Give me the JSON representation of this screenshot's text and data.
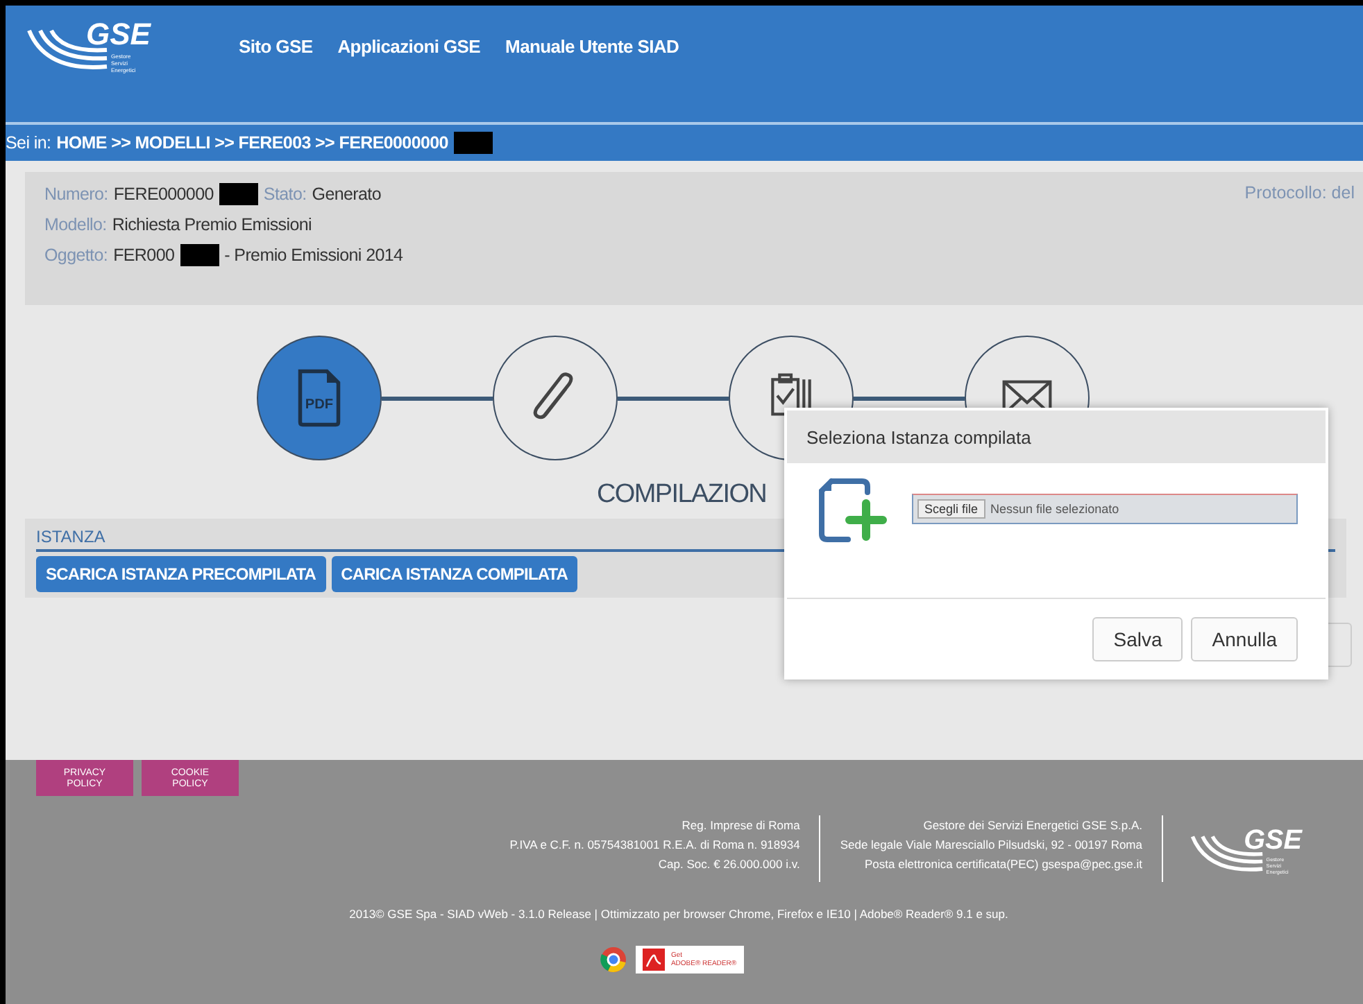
{
  "header": {
    "logo_text": "GSE",
    "logo_subtext": [
      "Gestore",
      "Servizi",
      "Energetici"
    ],
    "nav": [
      "Sito GSE",
      "Applicazioni GSE",
      "Manuale Utente SIAD"
    ]
  },
  "breadcrumb": {
    "prefix": "Sei in:",
    "path": "HOME >> MODELLI >> FERE003 >> FERE0000000",
    "redacted": true
  },
  "info": {
    "fields": [
      {
        "label": "Numero:",
        "value": "FERE000000",
        "redacted": true,
        "extra_label": "Stato:",
        "extra_value": "Generato"
      },
      {
        "label": "Modello:",
        "value": "Richiesta Premio Emissioni"
      },
      {
        "label": "Oggetto:",
        "value": "FER000",
        "redacted": true,
        "suffix": "- Premio Emissioni 2014"
      }
    ],
    "protocol": "Protocollo: del"
  },
  "steps": [
    {
      "kind": "pdf",
      "selected": true,
      "icon_text": "PDF"
    },
    {
      "kind": "attachment",
      "selected": false
    },
    {
      "kind": "checklist",
      "selected": false
    },
    {
      "kind": "mail",
      "selected": false
    }
  ],
  "section_title": "COMPILAZION",
  "istanza": {
    "label": "ISTANZA",
    "buttons": [
      "SCARICA ISTANZA PRECOMPILATA",
      "CARICA ISTANZA COMPILATA"
    ]
  },
  "dialog": {
    "title": "Seleziona Istanza compilata",
    "file_button": "Scegli file",
    "file_status": "Nessun file selezionato",
    "buttons": [
      "Salva",
      "Annulla"
    ]
  },
  "footer": {
    "policy_buttons": [
      [
        "PRIVACY",
        "POLICY"
      ],
      [
        "COOKIE",
        "POLICY"
      ]
    ],
    "left_lines": [
      "Reg. Imprese di Roma",
      "P.IVA e C.F. n. 05754381001 R.E.A. di Roma n. 918934",
      "Cap. Soc. € 26.000.000 i.v."
    ],
    "right_lines": [
      "Gestore dei Servizi Energetici GSE S.p.A.",
      "Sede legale Viale Maresciallo Pilsudski, 92 - 00197 Roma",
      "Posta elettronica certificata(PEC) gsespa@pec.gse.it"
    ],
    "copyright": "2013© GSE Spa - SIAD vWeb - 3.1.0 Release | Ottimizzato per browser Chrome, Firefox e IE10 | Adobe® Reader® 9.1 e sup.",
    "adobe_badge": [
      "Get",
      "ADOBE® READER®"
    ],
    "logo_text": "GSE",
    "logo_subtext": [
      "Gestore",
      "Servizi",
      "Energetici"
    ]
  }
}
